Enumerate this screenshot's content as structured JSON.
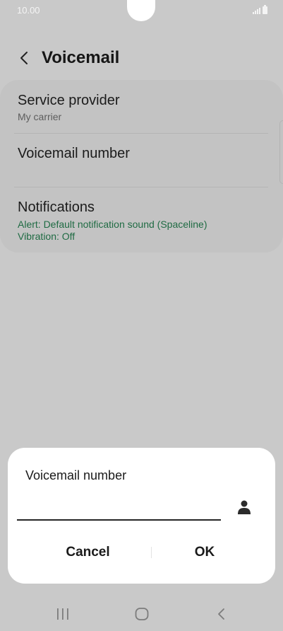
{
  "status_bar": {
    "time": "10.00"
  },
  "header": {
    "title": "Voicemail"
  },
  "settings": [
    {
      "title": "Service provider",
      "subtitle": "My carrier"
    },
    {
      "title": "Voicemail number",
      "subtitle": ""
    },
    {
      "title": "Notifications",
      "alert": "Alert: Default notification sound (Spaceline)",
      "vibration": "Vibration: Off"
    }
  ],
  "dialog": {
    "title": "Voicemail number",
    "input_value": "",
    "cancel_label": "Cancel",
    "ok_label": "OK"
  },
  "icons": {
    "back": "chevron-left-icon",
    "contact": "contact-person-icon",
    "nav_recent": "recent-apps-icon",
    "nav_home": "home-icon",
    "nav_back": "back-icon"
  },
  "colors": {
    "accent_green": "#1f6b43",
    "dim_background": "#c9c9c9",
    "dialog_background": "#ffffff"
  }
}
